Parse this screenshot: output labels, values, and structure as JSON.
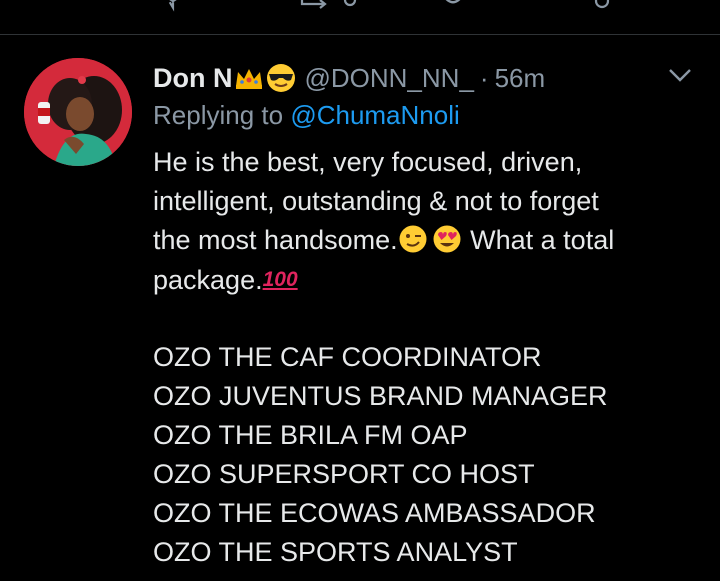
{
  "tweet": {
    "display_name": "Don N",
    "handle": "@DONN_NN_",
    "separator": "·",
    "time": "56m",
    "replying_to_label": "Replying to",
    "replying_to_handle": "@ChumaNnoli",
    "line1": "He is the best, very focused, driven,",
    "line2": "intelligent, outstanding & not to forget",
    "line3_start": "the most handsome.",
    "line3_end": " What a total",
    "line4_start": "package.",
    "hundred_emoji": "100",
    "list": [
      "OZO THE CAF COORDINATOR",
      "OZO JUVENTUS BRAND MANAGER",
      "OZO THE BRILA FM OAP",
      "OZO SUPERSPORT CO HOST",
      "OZO THE ECOWAS AMBASSADOR",
      "OZO THE SPORTS ANALYST"
    ]
  },
  "icons": [
    "reply-icon",
    "retweet-icon",
    "like-icon",
    "share-icon",
    "crown-emoji-icon",
    "sunglasses-emoji-icon",
    "chevron-down-icon",
    "wink-emoji-icon",
    "heart-eyes-emoji-icon",
    "hundred-emoji-icon"
  ],
  "colors": {
    "background": "#000000",
    "text": "#e7e9ea",
    "secondary": "#8b98a5",
    "link": "#1d9bf0",
    "divider": "#2f3336"
  }
}
